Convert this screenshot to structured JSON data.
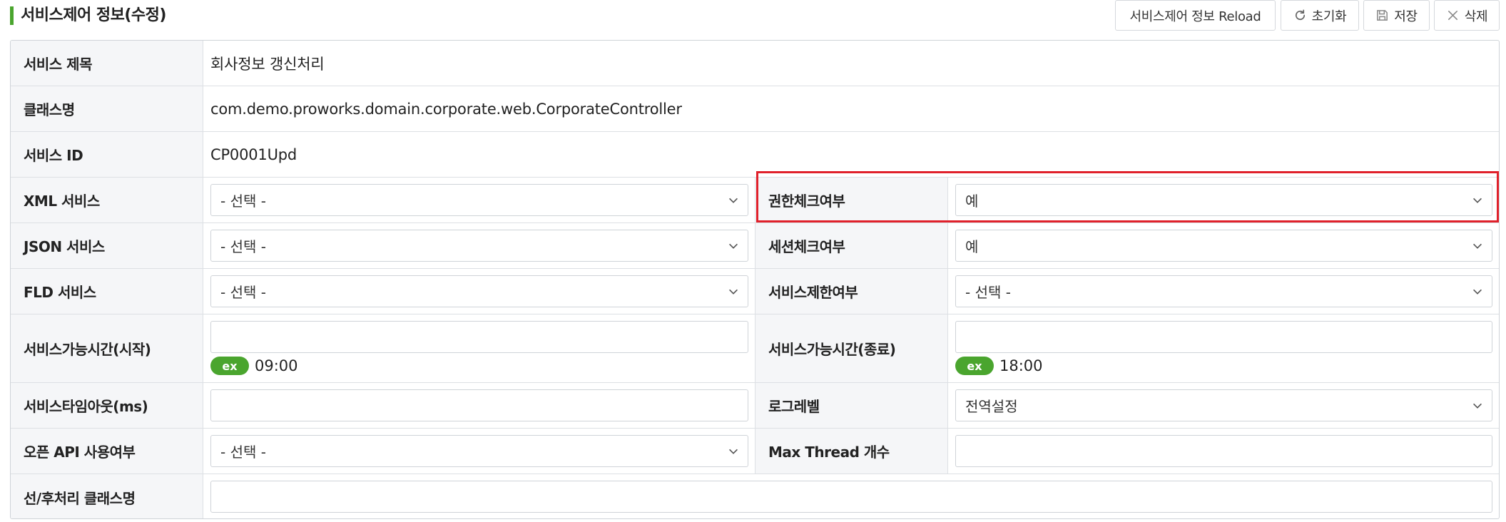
{
  "header": {
    "title": "서비스제어 정보(수정)",
    "buttons": {
      "reload": "서비스제어 정보 Reload",
      "reset": "초기화",
      "save": "저장",
      "delete": "삭제"
    },
    "accent_color": "#4aa52e"
  },
  "form": {
    "service_title": {
      "label": "서비스 제목",
      "value": "회사정보 갱신처리"
    },
    "class_name": {
      "label": "클래스명",
      "value": "com.demo.proworks.domain.corporate.web.CorporateController"
    },
    "service_id": {
      "label": "서비스 ID",
      "value": "CP0001Upd"
    },
    "xml_service": {
      "label": "XML 서비스",
      "selected": "- 선택 -"
    },
    "auth_check": {
      "label": "권한체크여부",
      "selected": "예"
    },
    "json_service": {
      "label": "JSON 서비스",
      "selected": "- 선택 -"
    },
    "session_check": {
      "label": "세션체크여부",
      "selected": "예"
    },
    "fld_service": {
      "label": "FLD 서비스",
      "selected": "- 선택 -"
    },
    "service_limit": {
      "label": "서비스제한여부",
      "selected": "- 선택 -"
    },
    "available_start": {
      "label": "서비스가능시간(시작)",
      "value": "",
      "hint_badge": "ex",
      "hint_value": "09:00"
    },
    "available_end": {
      "label": "서비스가능시간(종료)",
      "value": "",
      "hint_badge": "ex",
      "hint_value": "18:00"
    },
    "timeout": {
      "label": "서비스타임아웃(ms)",
      "value": ""
    },
    "log_level": {
      "label": "로그레벨",
      "selected": "전역설정"
    },
    "open_api": {
      "label": "오픈 API 사용여부",
      "selected": "- 선택 -"
    },
    "max_thread": {
      "label": "Max Thread 개수",
      "value": ""
    },
    "pre_post_class": {
      "label": "선/후처리 클래스명",
      "value": ""
    }
  },
  "highlight_color": "#e0212b"
}
